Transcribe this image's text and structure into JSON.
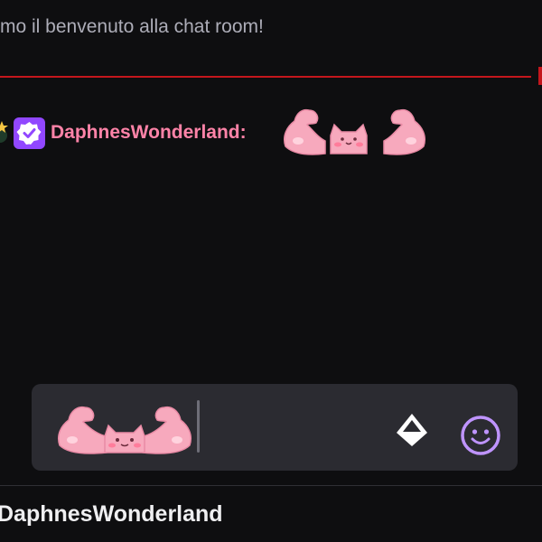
{
  "chat": {
    "welcome_text": "mo il benvenuto alla chat room!",
    "accent_color": "#c4161c"
  },
  "message": {
    "username": "DaphnesWonderland:",
    "username_color": "#ff83a8",
    "badges": [
      "star-badge-icon",
      "verified-badge-icon"
    ],
    "emote": "muscle-cat-emote"
  },
  "composer": {
    "emote": "muscle-cat-emote",
    "points_icon": "channel-points-icon",
    "emoji_icon": "emoji-picker-icon"
  },
  "footer": {
    "username": "DaphnesWonderland"
  }
}
